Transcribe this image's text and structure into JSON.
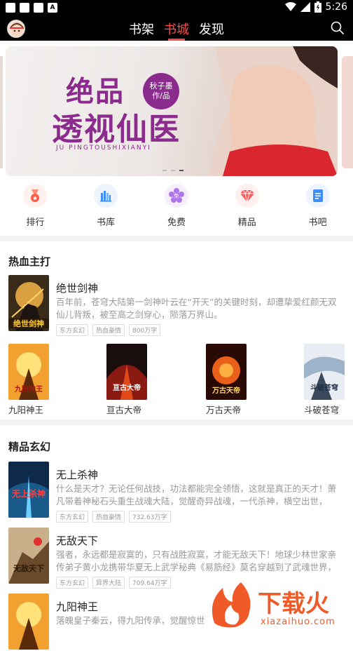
{
  "status": {
    "time": "5:26",
    "left_icon_4": "A"
  },
  "nav": {
    "tabs": [
      {
        "label": "书架"
      },
      {
        "label": "书城"
      },
      {
        "label": "发现"
      }
    ],
    "active_index": 1
  },
  "banner": {
    "title1": "绝品",
    "title2": "透视仙医",
    "author1": "秋子墨",
    "author2": "作/品",
    "subtitle": "JU  PINGTOUSHIXIANYI"
  },
  "categories": [
    {
      "label": "排行",
      "icon": "medal-icon",
      "color": "#ff6b57"
    },
    {
      "label": "书库",
      "icon": "library-icon",
      "color": "#3f8ef5"
    },
    {
      "label": "免费",
      "icon": "free-flower-icon",
      "color": "#a45de0"
    },
    {
      "label": "精品",
      "icon": "diamond-icon",
      "color": "#ff5a5a"
    },
    {
      "label": "书吧",
      "icon": "document-icon",
      "color": "#3f8ef5"
    }
  ],
  "section1": {
    "title": "热血主打",
    "featured": {
      "name": "绝世剑神",
      "desc": "百年前，苍穹大陆第一剑神叶云在“开天”的关键时刻，却遭挚爱红颜无双仙儿背叛，被至高之剑穿心，陨落万界山。",
      "tags": [
        "东方玄幻",
        "热血豪情",
        "800万字"
      ]
    },
    "grid": [
      {
        "label": "九阳神王"
      },
      {
        "label": "亘古大帝"
      },
      {
        "label": "万古天帝"
      },
      {
        "label": "斗破苍穹"
      }
    ]
  },
  "section2": {
    "title": "精品玄幻",
    "books": [
      {
        "name": "无上杀神",
        "desc": "什么是天才？无论任何战技，功法都能完全领悟，这就是真正的天才！萧凡带着神秘石头重生战魂大陆，觉醒奇异战魂，一代杀神，横空出世，",
        "tags": [
          "东方玄幻",
          "热血豪情",
          "732.63万字"
        ]
      },
      {
        "name": "无敌天下",
        "desc": "强者，永远都是寂寞的，只有战胜寂寞，才能无敌天下！地球少林世家亲传弟子黄小龙携带华夏无上武学秘典《易筋经》莫名穿越到了武魂世界，",
        "tags": [
          "东方玄幻",
          "异界大陆",
          "709.64万字"
        ]
      },
      {
        "name": "九阳神王",
        "desc": "落魄皇子秦云，得九阳传承，觉醒惊世"
      }
    ]
  },
  "watermark": {
    "brand": "下载火",
    "url": "xiazaihuo.com"
  }
}
